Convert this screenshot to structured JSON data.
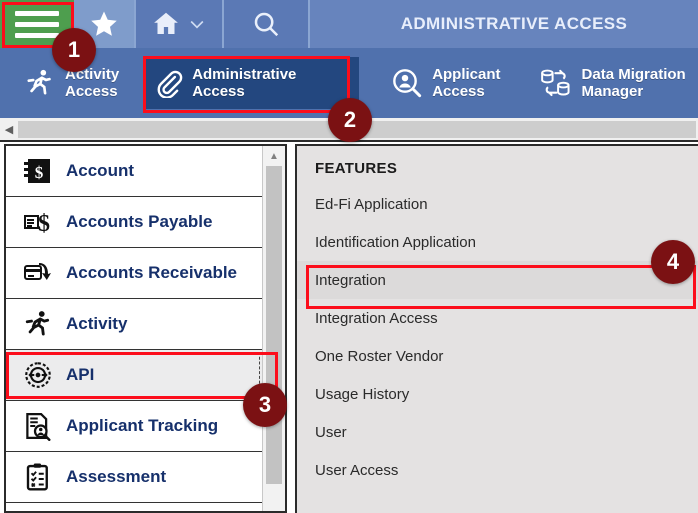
{
  "window": {
    "title": "ADMINISTRATIVE ACCESS"
  },
  "topbar": {
    "hamburger_icon": "hamburger-menu-icon",
    "favorite_icon": "star-icon",
    "home_icon": "home-icon",
    "home_chevron_icon": "chevron-down-icon",
    "search_icon": "search-icon"
  },
  "ribbon": {
    "items": [
      {
        "label": "Activity\nAccess",
        "icon": "running-person-icon",
        "active": false
      },
      {
        "label": "Administrative\nAccess",
        "icon": "paperclip-icon",
        "active": true
      },
      {
        "label": "Applicant\nAccess",
        "icon": "person-search-icon",
        "active": false
      },
      {
        "label": "Data Migration\nManager",
        "icon": "database-sync-icon",
        "active": false
      }
    ]
  },
  "sidebar": {
    "items": [
      {
        "label": "Account",
        "icon": "dollar-ledger-icon",
        "selected": false
      },
      {
        "label": "Accounts Payable",
        "icon": "invoice-dollar-icon",
        "selected": false
      },
      {
        "label": "Accounts Receivable",
        "icon": "card-arrow-down-icon",
        "selected": false
      },
      {
        "label": "Activity",
        "icon": "running-person-icon",
        "selected": false
      },
      {
        "label": "API",
        "icon": "gear-api-icon",
        "selected": true
      },
      {
        "label": "Applicant Tracking",
        "icon": "document-person-search-icon",
        "selected": false
      },
      {
        "label": "Assessment",
        "icon": "clipboard-check-icon",
        "selected": false
      }
    ],
    "scroll_up_icon": "scroll-up-arrow-icon"
  },
  "features": {
    "heading": "FEATURES",
    "items": [
      {
        "label": "Ed-Fi Application",
        "selected": false
      },
      {
        "label": "Identification Application",
        "selected": false
      },
      {
        "label": "Integration",
        "selected": true
      },
      {
        "label": "Integration Access",
        "selected": false
      },
      {
        "label": "One Roster Vendor",
        "selected": false
      },
      {
        "label": "Usage History",
        "selected": false
      },
      {
        "label": "User",
        "selected": false
      },
      {
        "label": "User Access",
        "selected": false
      }
    ]
  },
  "hscrollbar": {
    "left_arrow_icon": "scroll-left-arrow-icon"
  },
  "annotations": {
    "badges": [
      {
        "number": "1"
      },
      {
        "number": "2"
      },
      {
        "number": "3"
      },
      {
        "number": "4"
      }
    ],
    "highlight_color": "#fc0d1b",
    "badge_color": "#7b1113"
  }
}
